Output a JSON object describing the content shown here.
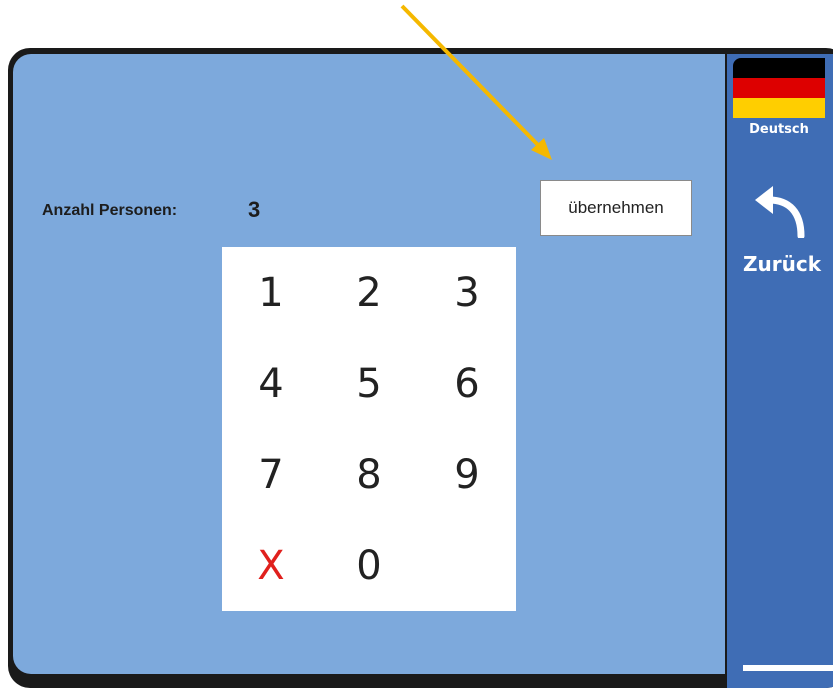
{
  "sidebar": {
    "language_label": "Deutsch",
    "back_label": "Zurück",
    "flag_colors": [
      "#000000",
      "#dd0000",
      "#ffce00"
    ]
  },
  "main": {
    "count_label": "Anzahl Personen:",
    "count_value": "3",
    "apply_label": "übernehmen"
  },
  "keypad": {
    "keys": [
      "1",
      "2",
      "3",
      "4",
      "5",
      "6",
      "7",
      "8",
      "9",
      "X",
      "0"
    ]
  },
  "colors": {
    "panel_bg": "#7da9dc",
    "sidebar_bg": "#3f6db5",
    "clear_key": "#e0201d",
    "annotation_arrow": "#f5b800"
  }
}
